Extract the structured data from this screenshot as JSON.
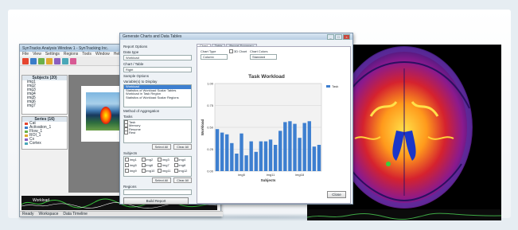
{
  "back_window": {
    "title": "SynTracks Analysis Window 1 - SynTracking Inc.",
    "menu": [
      "File",
      "View",
      "Settings",
      "Regions",
      "Tools",
      "Window",
      "Help"
    ],
    "subjects_header": "Subjects (20)",
    "subjects": [
      "img1",
      "img2",
      "img3",
      "img4",
      "img5",
      "img6",
      "img7"
    ],
    "series_header": "Series (16)",
    "series": [
      "Cat",
      "Activation_1",
      "Flow_1",
      "ROI_1",
      "Cx",
      "Cortex"
    ],
    "timeline_label": "View Timeline",
    "workload_label": "Workload",
    "status": "Ready",
    "tabs": [
      "Workspace",
      "Data Timeline"
    ]
  },
  "dialog": {
    "title": "Generate Charts and Data Tables",
    "section": "Report Options",
    "data_label": "Data type",
    "data_value": "Workload",
    "chart_by_label": "Chart / Table",
    "chart_by_value": "Right",
    "sample_label": "Sample Options",
    "variable_label": "Variable(s) to Display",
    "variables": [
      "Workload",
      "Statistics of Workload Scalar Tables",
      "Workload in Task Region",
      "Statistics of Workload Scalar Regions"
    ],
    "aggregate_label": "Method of Aggregation",
    "tasks_label": "Tasks",
    "tasks": [
      "Task",
      "Memory",
      "Resume",
      "Rest"
    ],
    "select_all": "Select All",
    "clear_all": "Clear All",
    "subjects_label": "Subjects",
    "subjects": [
      "img1",
      "img2",
      "img3",
      "img4",
      "img5",
      "img6",
      "img7",
      "img8",
      "img9",
      "img10",
      "img11",
      "img12"
    ],
    "regions_label": "Regions",
    "build_button": "Build Report",
    "close_button": "Close",
    "tabs": [
      "Chart",
      "Table",
      "Report Summary"
    ],
    "chart_type_label": "Chart Type",
    "chart_type_value": "Column",
    "threed_label": "3D Chart",
    "color_label": "Chart Colors",
    "color_value": "Standard"
  },
  "chart_data": {
    "type": "bar",
    "title": "Task Workload",
    "xlabel": "Subjects",
    "ylabel": "Workload",
    "ylim": [
      0,
      1.0
    ],
    "yticks": [
      "0.00",
      "0.25",
      "0.50",
      "0.75",
      "1.00"
    ],
    "tick_labels": [
      "img5",
      "img11",
      "img18"
    ],
    "legend": "Task",
    "color": "#3d7fd0",
    "values": [
      0.48,
      0.44,
      0.42,
      0.32,
      0.2,
      0.43,
      0.18,
      0.34,
      0.22,
      0.34,
      0.34,
      0.36,
      0.3,
      0.46,
      0.56,
      0.57,
      0.54,
      0.38,
      0.55,
      0.57,
      0.28,
      0.3
    ]
  }
}
